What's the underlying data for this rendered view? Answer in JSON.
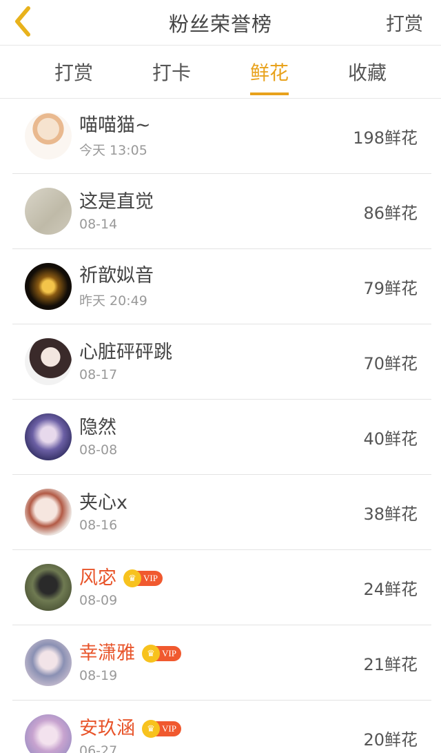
{
  "header": {
    "title": "粉丝荣誉榜",
    "action_label": "打赏"
  },
  "tabs": [
    {
      "label": "打赏"
    },
    {
      "label": "打卡"
    },
    {
      "label": "鲜花"
    },
    {
      "label": "收藏"
    }
  ],
  "active_tab": "鲜花",
  "vip_label": "VIP",
  "list": [
    {
      "name": "喵喵猫~",
      "time": "今天 13:05",
      "amount": "198鲜花",
      "vip": false
    },
    {
      "name": "这是直觉",
      "time": "08-14",
      "amount": "86鲜花",
      "vip": false
    },
    {
      "name": "祈歆姒音",
      "time": "昨天 20:49",
      "amount": "79鲜花",
      "vip": false
    },
    {
      "name": "心脏砰砰跳",
      "time": "08-17",
      "amount": "70鲜花",
      "vip": false
    },
    {
      "name": "隐然",
      "time": "08-08",
      "amount": "40鲜花",
      "vip": false
    },
    {
      "name": "夹心x",
      "time": "08-16",
      "amount": "38鲜花",
      "vip": false
    },
    {
      "name": "风宓",
      "time": "08-09",
      "amount": "24鲜花",
      "vip": true
    },
    {
      "name": "幸潇雅",
      "time": "08-19",
      "amount": "21鲜花",
      "vip": true
    },
    {
      "name": "安玖涵",
      "time": "06-27",
      "amount": "20鲜花",
      "vip": true
    }
  ],
  "colors": {
    "accent": "#e8a21c",
    "vip_name": "#e8542a",
    "vip_badge": "#f0592f"
  }
}
